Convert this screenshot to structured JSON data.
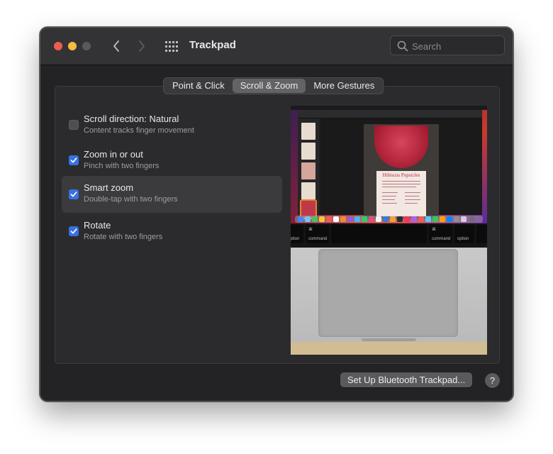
{
  "window": {
    "title": "Trackpad"
  },
  "search": {
    "placeholder": "Search"
  },
  "tabs": [
    {
      "label": "Point & Click",
      "active": false
    },
    {
      "label": "Scroll & Zoom",
      "active": true
    },
    {
      "label": "More Gestures",
      "active": false
    }
  ],
  "options": [
    {
      "title": "Scroll direction: Natural",
      "subtitle": "Content tracks finger movement",
      "checked": false,
      "selected": false
    },
    {
      "title": "Zoom in or out",
      "subtitle": "Pinch with two fingers",
      "checked": true,
      "selected": false
    },
    {
      "title": "Smart zoom",
      "subtitle": "Double-tap with two fingers",
      "checked": true,
      "selected": true
    },
    {
      "title": "Rotate",
      "subtitle": "Rotate with two fingers",
      "checked": true,
      "selected": false
    }
  ],
  "preview": {
    "page_heading": "Hibiscus Popsicles",
    "keys": {
      "left_option": "option",
      "left_command": "command",
      "right_command": "command",
      "right_option": "option"
    }
  },
  "footer": {
    "bluetooth_button": "Set Up Bluetooth Trackpad...",
    "help_button": "?"
  },
  "colors": {
    "accent": "#3671e5",
    "close": "#ee5d50",
    "minimize": "#f3bd3f"
  }
}
